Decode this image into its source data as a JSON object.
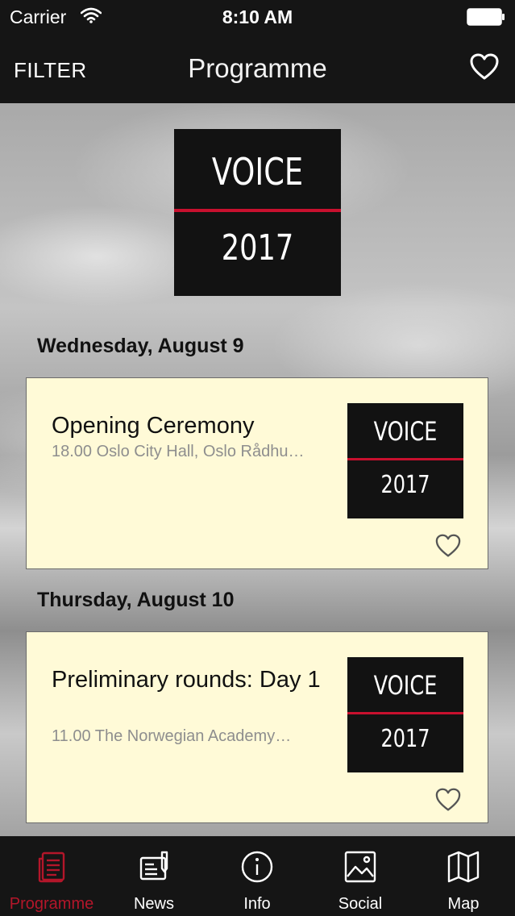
{
  "status_bar": {
    "carrier": "Carrier",
    "time": "8:10 AM"
  },
  "nav": {
    "filter_label": "FILTER",
    "title": "Programme",
    "favorites_icon": "heart-outline-icon"
  },
  "hero_logo": {
    "word": "VOICE",
    "year": "2017"
  },
  "colors": {
    "accent_red": "#c8102e",
    "active_tab": "#b3162a",
    "card_bg": "#fffad7",
    "bar_bg": "#151515"
  },
  "days": [
    {
      "header": "Wednesday, August 9",
      "event": {
        "title": "Opening Ceremony",
        "meta": "18.00 Oslo City Hall, Oslo Rådhu…",
        "logo_word": "VOICE",
        "logo_year": "2017"
      }
    },
    {
      "header": "Thursday, August 10",
      "event": {
        "title": "Preliminary rounds: Day 1",
        "meta": "11.00 The Norwegian Academy…",
        "logo_word": "VOICE",
        "logo_year": "2017"
      }
    }
  ],
  "tabs": [
    {
      "label": "Programme",
      "icon": "programme-icon",
      "active": true
    },
    {
      "label": "News",
      "icon": "news-icon",
      "active": false
    },
    {
      "label": "Info",
      "icon": "info-icon",
      "active": false
    },
    {
      "label": "Social",
      "icon": "image-icon",
      "active": false
    },
    {
      "label": "Map",
      "icon": "map-icon",
      "active": false
    }
  ]
}
